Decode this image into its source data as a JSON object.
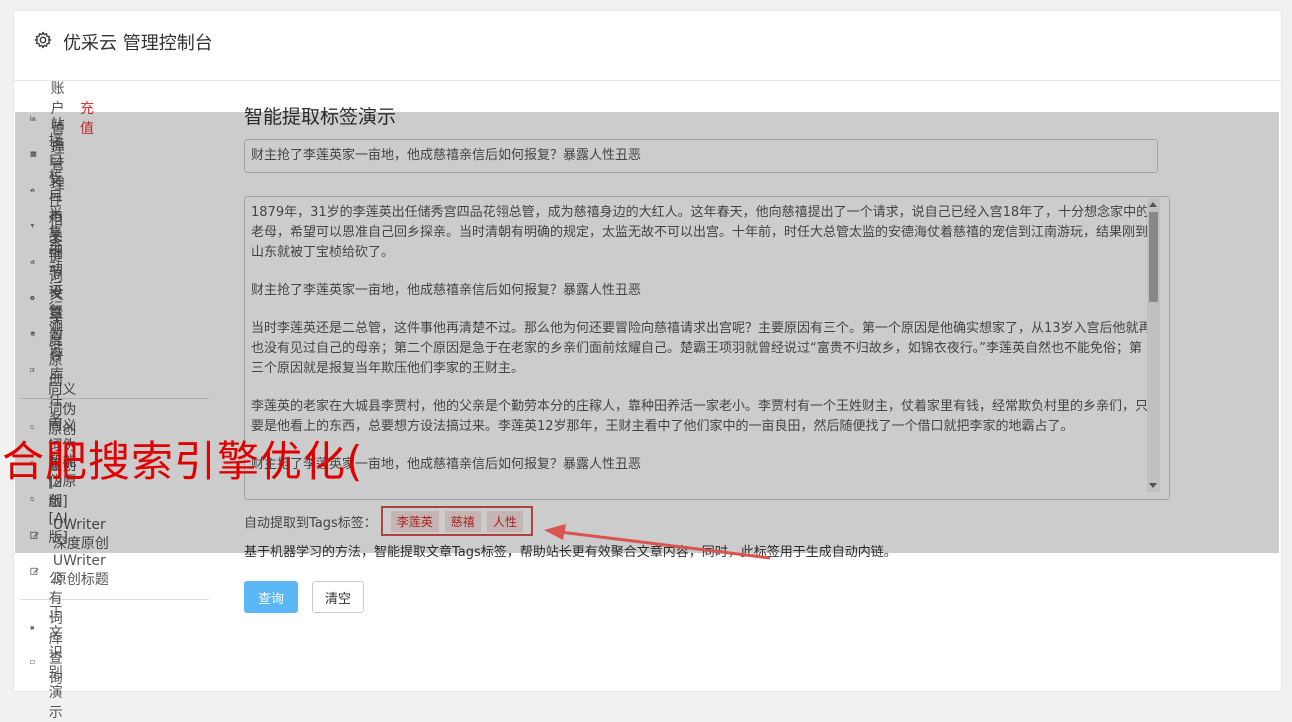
{
  "header": {
    "title": "优采云 管理控制台"
  },
  "sidebar": {
    "items": [
      {
        "label": "账户管理",
        "badge": "充值",
        "icon": "bar-chart-icon"
      },
      {
        "label": "站点管理",
        "icon": "server-icon"
      },
      {
        "label": "接口文件相关",
        "icon": "cloud-upload-icon"
      },
      {
        "label": "栏目与关键词",
        "icon": "filter-icon"
      },
      {
        "label": "采集细节设置",
        "icon": "gears-icon"
      },
      {
        "label": "手动运行测试",
        "icon": "play-circle-icon"
      },
      {
        "label": "文章暂存库",
        "icon": "database-icon"
      },
      {
        "label": "深度原创任务",
        "icon": "edit-icon"
      },
      {
        "label": "同义词伪原创[1版]",
        "icon": "refresh-icon"
      },
      {
        "label": "同义词伪原创[2版]",
        "icon": "refresh-icon"
      },
      {
        "label": "智能伪原创[AI版]",
        "icon": "refresh-icon"
      },
      {
        "label": "UWriter深度原创",
        "icon": "edit-icon"
      },
      {
        "label": "UWriter原创标题",
        "icon": "edit-icon"
      },
      {
        "label": "公有词库查询",
        "icon": "book-icon"
      },
      {
        "label": "正文识别演示",
        "icon": "square-icon"
      }
    ]
  },
  "main": {
    "title": "智能提取标签演示",
    "title_input_value": "财主抢了李莲英家一亩地，他成慈禧亲信后如何报复？暴露人性丑恶",
    "content_paragraphs": [
      "1879年，31岁的李莲英出任储秀宫四品花翎总管，成为慈禧身边的大红人。这年春天，他向慈禧提出了一个请求，说自己已经入宫18年了，十分想念家中的老母，希望可以恩准自己回乡探亲。当时清朝有明确的规定，太监无故不可以出宫。十年前，时任大总管太监的安德海仗着慈禧的宠信到江南游玩，结果刚到山东就被丁宝桢给砍了。",
      "财主抢了李莲英家一亩地，他成慈禧亲信后如何报复？暴露人性丑恶",
      "当时李莲英还是二总管，这件事他再清楚不过。那么他为何还要冒险向慈禧请求出宫呢？主要原因有三个。第一个原因是他确实想家了，从13岁入宫后他就再也没有见过自己的母亲；第二个原因是急于在老家的乡亲们面前炫耀自己。楚霸王项羽就曾经说过“富贵不归故乡，如锦衣夜行。”李莲英自然也不能免俗；第三个原因就是报复当年欺压他们李家的王财主。",
      "李莲英的老家在大城县李贾村，他的父亲是个勤劳本分的庄稼人，靠种田养活一家老小。李贾村有一个王姓财主，仗着家里有钱，经常欺负村里的乡亲们，只要是他看上的东西，总要想方设法搞过来。李莲英12岁那年，王财主看中了他们家中的一亩良田，然后随便找了一个借口就把李家的地霸占了。",
      "财主抢了李莲英家一亩地，他成慈禧亲信后如何报复？暴露人性丑恶"
    ],
    "tags_label": "自动提取到Tags标签：",
    "tags": [
      "李莲英",
      "慈禧",
      "人性"
    ],
    "description": "基于机器学习的方法，智能提取文章Tags标签，帮助站长更有效聚合文章内容，同时，此标签用于生成自动内链。",
    "query_button": "查询",
    "clear_button": "清空"
  },
  "watermark": "合肥搜索引擎优化(",
  "colors": {
    "accent": "#5bb7f5",
    "highlight": "#d9534f",
    "watermark": "#e00000"
  }
}
